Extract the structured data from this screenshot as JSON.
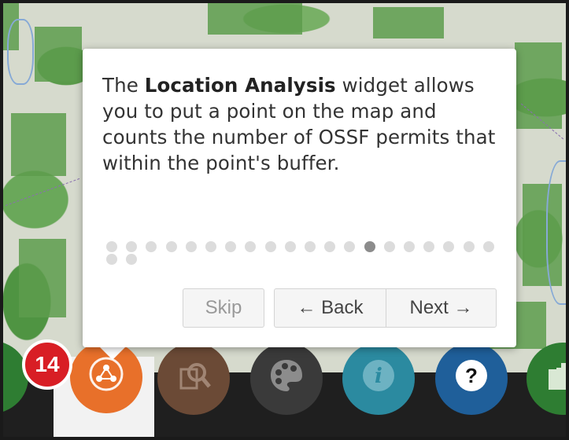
{
  "map": {
    "label": ""
  },
  "tour": {
    "text_before": "The ",
    "text_bold": "Location Analysis",
    "text_after": " widget allows you to put a point on the map and counts the number of OSSF permits that within the point's buffer.",
    "step_current": 14,
    "step_total": 22,
    "skip_label": "Skip",
    "back_label": "← Back",
    "next_label": "Next →"
  },
  "badge": {
    "value": "14"
  },
  "toolbar": {
    "buttons": [
      {
        "name": "partial-left-widget",
        "icon": "partial-icon",
        "color": "#2e7d32"
      },
      {
        "name": "location-analysis",
        "icon": "network-pin-icon",
        "color": "#e8702a",
        "active": true
      },
      {
        "name": "search-query",
        "icon": "magnifier-doc-icon",
        "color": "#6b4a36"
      },
      {
        "name": "basemap-gallery",
        "icon": "palette-icon",
        "color": "#3a3a3a"
      },
      {
        "name": "info",
        "icon": "info-icon",
        "color": "#2b8aa0"
      },
      {
        "name": "help",
        "icon": "question-icon",
        "color": "#1f5f9a"
      },
      {
        "name": "add-data",
        "icon": "add-data-icon",
        "color": "#2e7d32"
      }
    ]
  }
}
